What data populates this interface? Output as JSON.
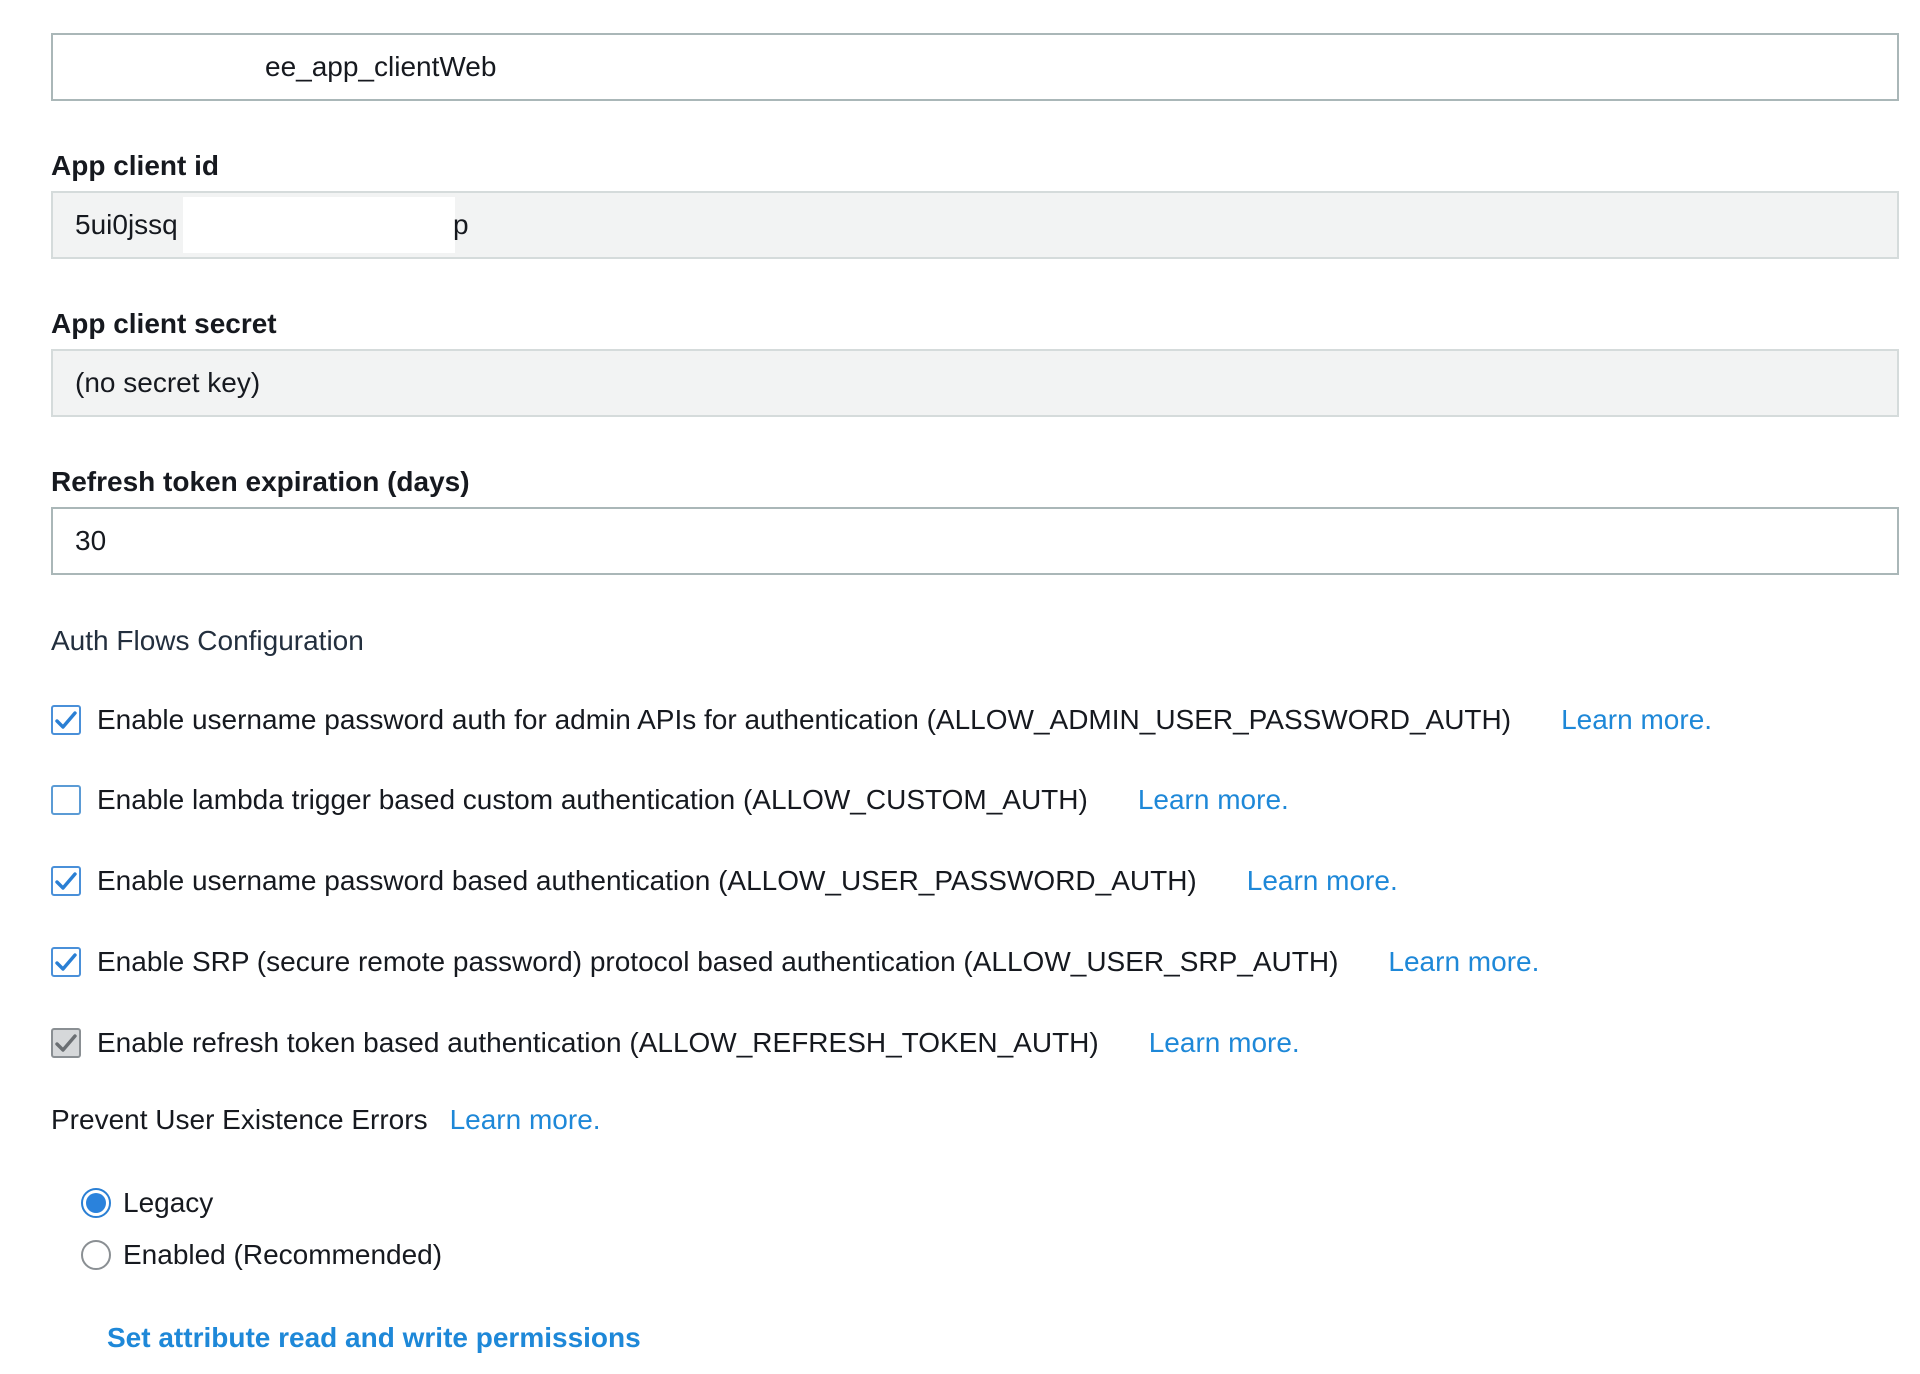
{
  "app_client_name": {
    "value": "ee_app_clientWeb"
  },
  "app_client_id": {
    "label": "App client id",
    "value_start": "5ui0jssq",
    "value_end": "p"
  },
  "app_client_secret": {
    "label": "App client secret",
    "value": "(no secret key)"
  },
  "refresh_token": {
    "label": "Refresh token expiration (days)",
    "value": "30"
  },
  "auth_flows": {
    "title": "Auth Flows Configuration",
    "items": [
      {
        "label": "Enable username password auth for admin APIs for authentication (ALLOW_ADMIN_USER_PASSWORD_AUTH)",
        "checked": true,
        "disabled": false,
        "link": "Learn more."
      },
      {
        "label": "Enable lambda trigger based custom authentication (ALLOW_CUSTOM_AUTH)",
        "checked": false,
        "disabled": false,
        "link": "Learn more."
      },
      {
        "label": "Enable username password based authentication (ALLOW_USER_PASSWORD_AUTH)",
        "checked": true,
        "disabled": false,
        "link": "Learn more."
      },
      {
        "label": "Enable SRP (secure remote password) protocol based authentication (ALLOW_USER_SRP_AUTH)",
        "checked": true,
        "disabled": false,
        "link": "Learn more."
      },
      {
        "label": "Enable refresh token based authentication (ALLOW_REFRESH_TOKEN_AUTH)",
        "checked": true,
        "disabled": true,
        "link": "Learn more."
      }
    ]
  },
  "prevent_user_existence": {
    "title": "Prevent User Existence Errors",
    "link": "Learn more.",
    "options": [
      {
        "label": "Legacy",
        "selected": true
      },
      {
        "label": "Enabled (Recommended)",
        "selected": false
      }
    ]
  },
  "permissions_link": "Set attribute read and write permissions",
  "colors": {
    "link": "#1e88d8",
    "checkbox_accent": "#2a7fd4",
    "disabled_check": "#6b6f73",
    "readonly_bg": "#f2f3f3",
    "border": "#aab7b8"
  }
}
